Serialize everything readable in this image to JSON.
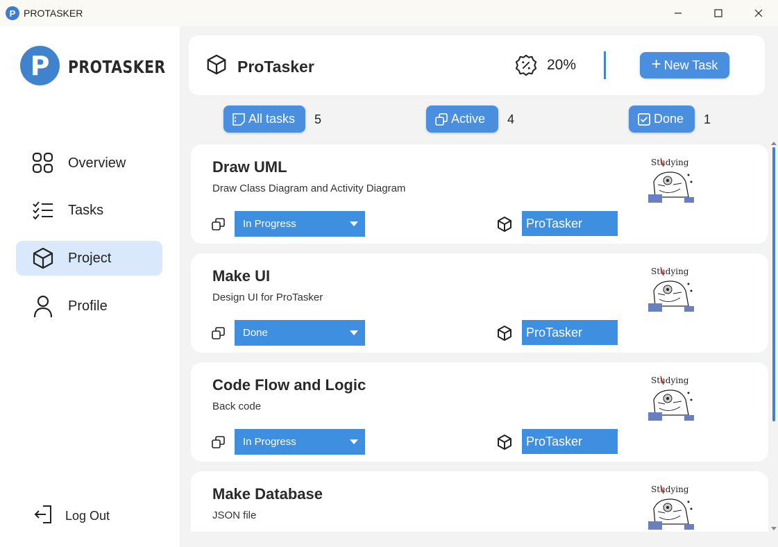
{
  "window": {
    "title": "PROTASKER",
    "app_icon_letter": "P"
  },
  "sidebar": {
    "logo_letter": "P",
    "logo_text": "PROTASKER",
    "items": [
      {
        "label": "Overview",
        "icon": "grid-icon",
        "active": false
      },
      {
        "label": "Tasks",
        "icon": "checklist-icon",
        "active": false
      },
      {
        "label": "Project",
        "icon": "cube-icon",
        "active": true
      },
      {
        "label": "Profile",
        "icon": "user-icon",
        "active": false
      }
    ],
    "logout_label": "Log Out"
  },
  "header": {
    "project_name": "ProTasker",
    "progress_percent": "20%",
    "new_task_label": "New Task"
  },
  "filters": [
    {
      "label": "All tasks",
      "count": "5",
      "icon": "sticky-note-icon"
    },
    {
      "label": "Active",
      "count": "4",
      "icon": "copy-icon"
    },
    {
      "label": "Done",
      "count": "1",
      "icon": "checkbox-icon"
    }
  ],
  "tasks": [
    {
      "title": "Draw UML",
      "description": "Draw Class Diagram and Activity Diagram",
      "status": "In Progress",
      "project": "ProTasker",
      "image_caption": "Studying"
    },
    {
      "title": "Make UI",
      "description": "Design UI for ProTasker",
      "status": "Done",
      "project": "ProTasker",
      "image_caption": "Studying"
    },
    {
      "title": "Code Flow and Logic",
      "description": "Back code",
      "status": "In Progress",
      "project": "ProTasker",
      "image_caption": "Studying"
    },
    {
      "title": "Make Database",
      "description": "JSON file",
      "status": "",
      "project": "",
      "image_caption": "Studying"
    }
  ],
  "colors": {
    "accent": "#4a8fdf",
    "active_nav_bg": "#d9e8fa",
    "sidebar_bg": "#ffffff",
    "content_bg": "#f3f3f3"
  }
}
